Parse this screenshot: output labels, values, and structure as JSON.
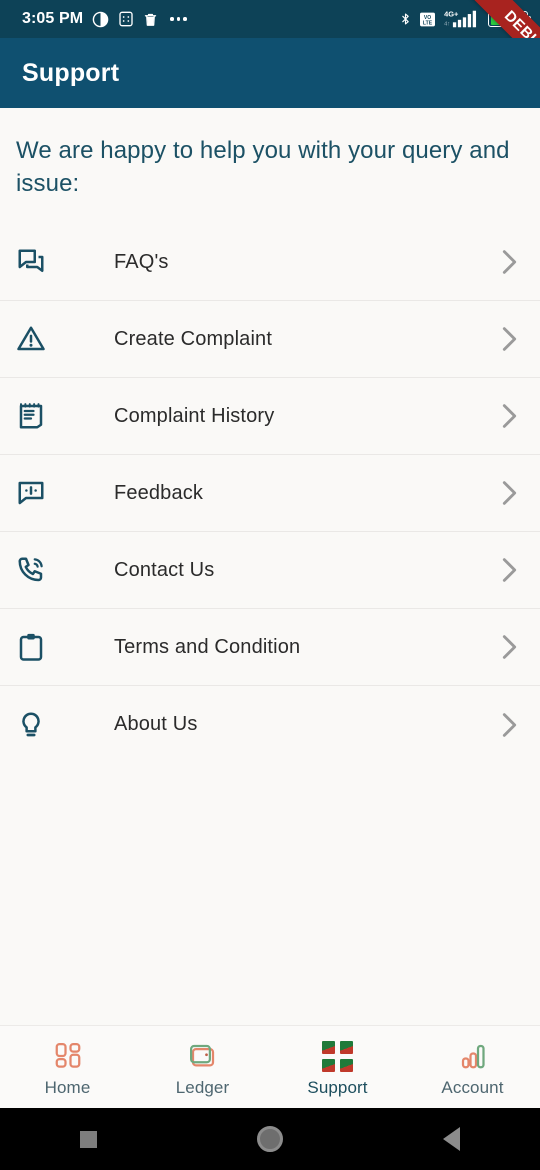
{
  "statusbar": {
    "time": "3:05 PM",
    "battery_level": "55",
    "network_type": "4G+",
    "volte_label": "VoLTE",
    "icons": [
      "do-not-disturb-icon",
      "calculator-icon",
      "trash-icon",
      "overflow-dots-icon",
      "bluetooth-icon",
      "volte-icon",
      "signal-bars-icon",
      "battery-icon"
    ]
  },
  "debug_ribbon": {
    "label": "DEBUG",
    "color": "#A8231F"
  },
  "header": {
    "title": "Support",
    "background": "#0F5070"
  },
  "main": {
    "intro_text": "We are happy to help you with your query and issue:",
    "items": [
      {
        "label": "FAQ's",
        "icon": "forum-chat-icon"
      },
      {
        "label": "Create Complaint",
        "icon": "warning-triangle-icon"
      },
      {
        "label": "Complaint History",
        "icon": "receipt-notepad-icon"
      },
      {
        "label": "Feedback",
        "icon": "speech-bubble-alert-icon"
      },
      {
        "label": "Contact Us",
        "icon": "phone-ringing-icon"
      },
      {
        "label": "Terms and Condition",
        "icon": "clipboard-icon"
      },
      {
        "label": "About Us",
        "icon": "lightbulb-icon"
      }
    ]
  },
  "bottom_nav": {
    "active": "Support",
    "tabs": [
      {
        "label": "Home",
        "icon": "dashboard-grid-icon"
      },
      {
        "label": "Ledger",
        "icon": "wallet-icon"
      },
      {
        "label": "Support",
        "icon": "broken-image-icon"
      },
      {
        "label": "Account",
        "icon": "bar-chart-icon"
      }
    ]
  },
  "android_nav": {
    "buttons": [
      {
        "name": "recents",
        "icon": "square-icon"
      },
      {
        "name": "home",
        "icon": "circle-icon"
      },
      {
        "name": "back",
        "icon": "triangle-left-icon"
      }
    ]
  },
  "colors": {
    "statusbar_bg": "#0D4257",
    "header_bg": "#0F5070",
    "page_bg": "#FAF9F7",
    "icon_teal": "#1B5065",
    "accent_orange": "#E4866B",
    "accent_green": "#6FA87E",
    "divider": "#EAE8E6"
  }
}
